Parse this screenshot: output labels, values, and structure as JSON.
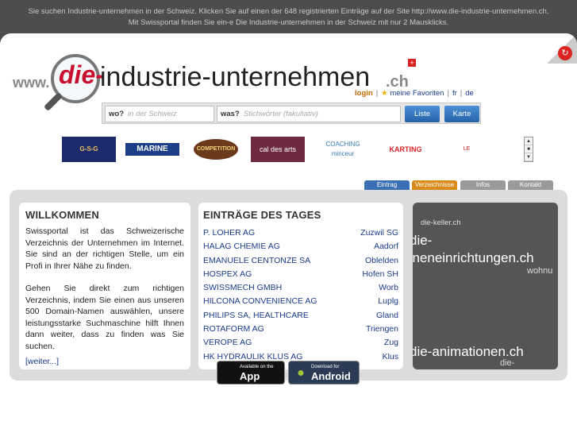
{
  "topbar": {
    "line1": "Sie suchen Industrie-unternehmen in der Schweiz. Klicken Sie auf einen der 648 registrierten Einträge auf der Site http://www.die-industrie-unternehmen.ch.",
    "line2": "Mit Swissportal finden Sie ein-e Die Industrie-unternehmen in der Schweiz mit nur 2 Mausklicks."
  },
  "logo": {
    "www": "www.",
    "die": "die-",
    "name": "industrie-unternehmen",
    "tld": ".ch"
  },
  "toplinks": {
    "login": "login",
    "favorites": "meine Favoriten",
    "fr": "fr",
    "de": "de"
  },
  "search": {
    "wo_label": "wo?",
    "wo_placeholder": "in der Schweiz",
    "was_label": "was?",
    "was_placeholder": "Stichwörter (fakultativ)",
    "liste": "Liste",
    "karte": "Karte"
  },
  "banners": [
    "G-S-G",
    "MARINE",
    "COMPETITION",
    "cal des arts",
    "COACHING minceur",
    "KARTING VUITEBOEUF",
    "LE"
  ],
  "tabs": {
    "eintrag": "Eintrag",
    "verzeichnisse": "Verzeichnisse",
    "infos": "Infos",
    "kontakt": "Kontakt"
  },
  "welcome": {
    "title": "WILLKOMMEN",
    "p1": "Swissportal ist das Schweizerische Verzeichnis der Unternehmen im Internet. Sie sind an der richtigen Stelle, um ein Profi in Ihrer Nähe zu finden.",
    "p2": "Gehen Sie direkt zum richtigen Verzeichnis, indem Sie einen aus unseren 500 Domain-Namen auswählen, unsere leistungsstarke Suchmaschine hilft Ihnen dann weiter, dass zu finden was Sie suchen.",
    "more": "[weiter...]"
  },
  "entries": {
    "title": "EINTRÄGE DES TAGES",
    "items": [
      {
        "name": "P. LOHER AG",
        "city": "Zuzwil SG"
      },
      {
        "name": "HALAG CHEMIE AG",
        "city": "Aadorf"
      },
      {
        "name": "EMANUELE CENTONZE SA",
        "city": "Oblelden"
      },
      {
        "name": "HOSPEX AG",
        "city": "Hofen SH"
      },
      {
        "name": "SWISSMECH GMBH",
        "city": "Worb"
      },
      {
        "name": "HILCONA CONVENIENCE AG",
        "city": "Luplg"
      },
      {
        "name": "PHILIPS SA, HEALTHCARE",
        "city": "Gland"
      },
      {
        "name": "ROTAFORM AG",
        "city": "Triengen"
      },
      {
        "name": "VEROPE AG",
        "city": "Zug"
      },
      {
        "name": "HK HYDRAULIK KLUS AG",
        "city": "Klus"
      }
    ]
  },
  "promo": {
    "t1": "die-keller.ch",
    "t2": "die-",
    "t3": "nneneinrichtungen.ch",
    "t4": "wohnu",
    "t5": "die-animationen.ch",
    "t6": "die-"
  },
  "stores": {
    "apple_small": "Available on the",
    "apple_big": "App Store",
    "android_small": "Download for",
    "android_big": "Android"
  }
}
